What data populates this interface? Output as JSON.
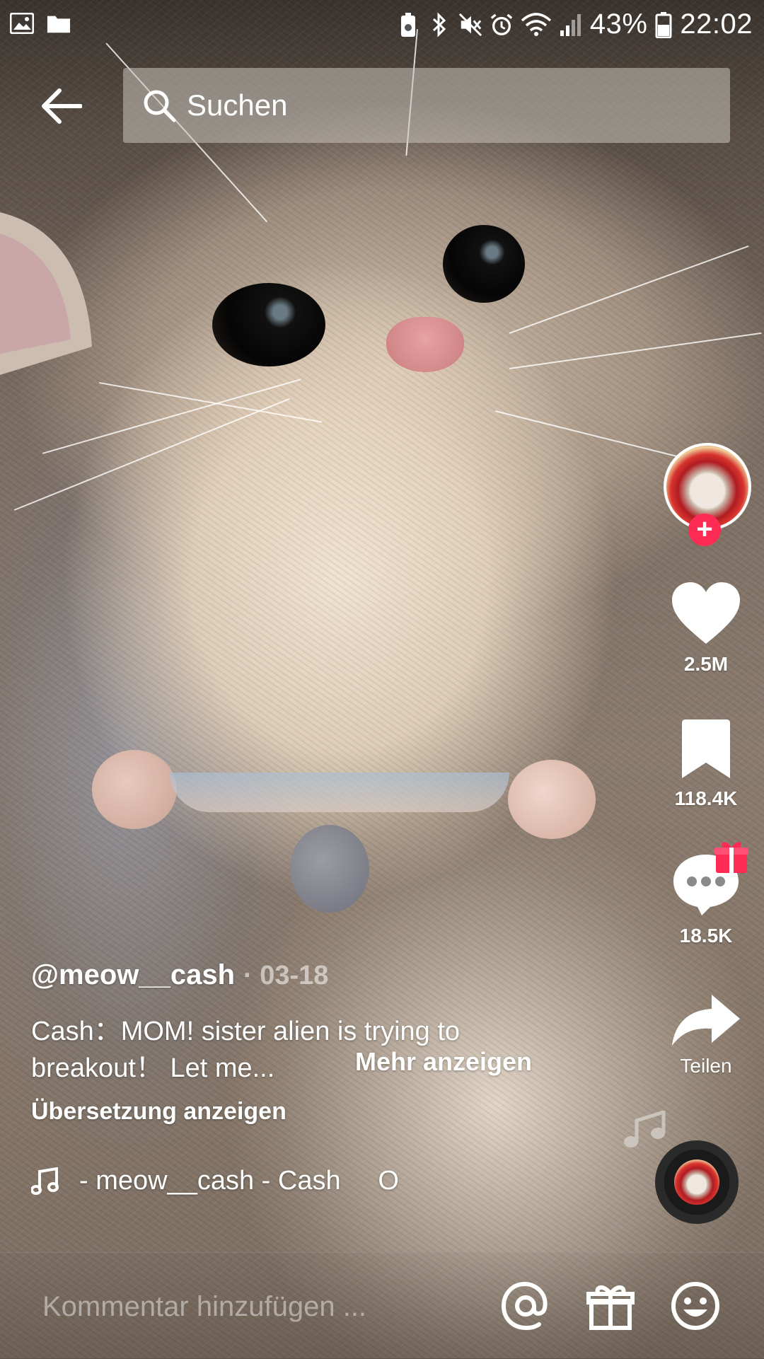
{
  "status_bar": {
    "battery_percent": "43%",
    "time": "22:02",
    "icons": [
      "gallery-icon",
      "folder-icon",
      "battery-saver-icon",
      "bluetooth-icon",
      "mute-icon",
      "alarm-icon",
      "wifi-icon",
      "signal-icon",
      "battery-icon"
    ]
  },
  "top_bar": {
    "back_icon": "arrow-left-icon",
    "search_placeholder": "Suchen"
  },
  "actions": {
    "likes": "2.5M",
    "saves": "118.4K",
    "comments": "18.5K",
    "share_label": "Teilen"
  },
  "post": {
    "username": "@meow__cash",
    "date": "· 03-18",
    "caption": "Cash：MOM! sister alien is trying to breakout！ Let me...",
    "more_label": "Mehr anzeigen",
    "translate_label": "Übersetzung anzeigen",
    "sound": "- meow__cash - Cash     O"
  },
  "comment_bar": {
    "placeholder": "Kommentar hinzufügen ...",
    "icons": [
      "mention-icon",
      "gift-icon",
      "emoji-icon"
    ]
  },
  "colors": {
    "accent": "#fe2c55",
    "text": "#ffffff"
  }
}
